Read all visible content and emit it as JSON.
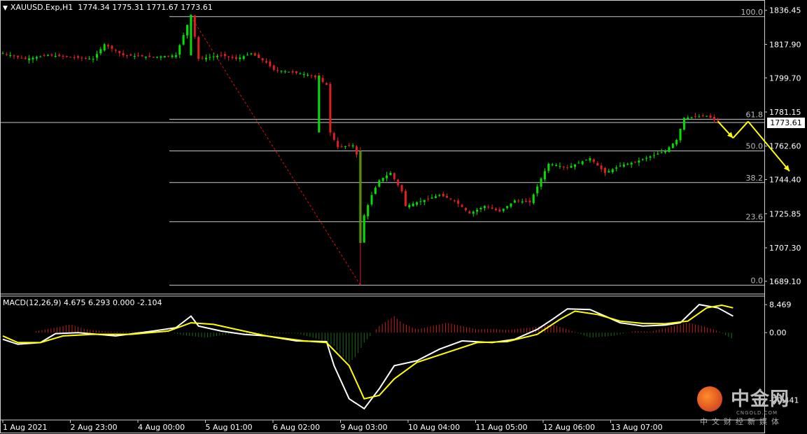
{
  "header": {
    "symbol": "XAUUSD.Exp,H1",
    "ohlc": "1774.34 1775.31 1771.67 1773.61"
  },
  "macd_header": {
    "label": "MACD(12,26,9) 4.675 6.293 0.000 -2.104"
  },
  "current_price": "1773.61",
  "logo": {
    "name": "中金网",
    "sub": "CNGOLD.COM",
    "tag": "中文财经新媒体"
  },
  "chart_data": [
    {
      "type": "candlestick",
      "title": "XAUUSD.Exp,H1",
      "price_axis_ticks": [
        "1836.45",
        "1817.90",
        "1799.70",
        "1781.15",
        "1762.60",
        "1744.40",
        "1725.85",
        "1707.30",
        "1689.10"
      ],
      "price_axis_values": [
        1836.45,
        1817.9,
        1799.7,
        1781.15,
        1762.6,
        1744.4,
        1725.85,
        1707.3,
        1689.1
      ],
      "ylim": [
        1686,
        1839
      ],
      "x_tick_labels": [
        "1 Aug 2021",
        "2 Aug 23:00",
        "4 Aug 00:00",
        "5 Aug 01:00",
        "6 Aug 02:00",
        "9 Aug 03:00",
        "10 Aug 04:00",
        "11 Aug 05:00",
        "12 Aug 06:00",
        "13 Aug 07:00"
      ],
      "fibonacci": {
        "high": 1833.0,
        "low": 1687.0,
        "levels": [
          {
            "label": "100.0",
            "price": 1833.0
          },
          {
            "label": "61.8",
            "price": 1777.2
          },
          {
            "label": "50.0",
            "price": 1760.0
          },
          {
            "label": "38.2",
            "price": 1742.8
          },
          {
            "label": "23.6",
            "price": 1721.5
          },
          {
            "label": "0.0",
            "price": 1687.0
          }
        ]
      },
      "price_path": [
        [
          0,
          1813
        ],
        [
          6,
          1810
        ],
        [
          12,
          1812
        ],
        [
          18,
          1811
        ],
        [
          24,
          1810
        ],
        [
          27,
          1818
        ],
        [
          32,
          1812
        ],
        [
          40,
          1811
        ],
        [
          46,
          1812
        ],
        [
          50,
          1834
        ],
        [
          52,
          1810
        ],
        [
          58,
          1812
        ],
        [
          62,
          1810
        ],
        [
          66,
          1813
        ],
        [
          70,
          1808
        ],
        [
          72,
          1804
        ],
        [
          76,
          1803
        ],
        [
          82,
          1801
        ],
        [
          84,
          1799
        ],
        [
          86,
          1796
        ],
        [
          87,
          1770
        ],
        [
          89,
          1762
        ],
        [
          93,
          1763
        ],
        [
          94,
          1758
        ],
        [
          95,
          1710
        ],
        [
          96,
          1725
        ],
        [
          98,
          1736
        ],
        [
          100,
          1744
        ],
        [
          103,
          1748
        ],
        [
          106,
          1738
        ],
        [
          107,
          1730
        ],
        [
          110,
          1732
        ],
        [
          116,
          1736
        ],
        [
          120,
          1733
        ],
        [
          124,
          1726
        ],
        [
          128,
          1730
        ],
        [
          132,
          1727
        ],
        [
          136,
          1733
        ],
        [
          140,
          1732
        ],
        [
          143,
          1745
        ],
        [
          145,
          1753
        ],
        [
          150,
          1751
        ],
        [
          156,
          1756
        ],
        [
          160,
          1748
        ],
        [
          164,
          1752
        ],
        [
          168,
          1754
        ],
        [
          172,
          1757
        ],
        [
          176,
          1760
        ],
        [
          179,
          1766
        ],
        [
          181,
          1778
        ],
        [
          187,
          1779
        ],
        [
          190,
          1776
        ]
      ],
      "current_price": 1773.61,
      "projection": [
        [
          190,
          1776
        ],
        [
          194,
          1767
        ],
        [
          198,
          1776
        ],
        [
          209,
          1749
        ]
      ]
    },
    {
      "type": "line",
      "title": "MACD(12,26,9)",
      "values_shown": {
        "macd": 4.675,
        "signal": 6.293,
        "level": 0.0,
        "histogram": -2.104
      },
      "axis_ticks": [
        "8.469",
        "0.00",
        "-20.441"
      ],
      "axis_values": [
        8.469,
        0.0,
        -20.441
      ],
      "ylim": [
        -26,
        10
      ],
      "series": [
        {
          "name": "MACD",
          "color": "#ffffff",
          "values": [
            [
              0,
              -2
            ],
            [
              4,
              -3.5
            ],
            [
              10,
              -3
            ],
            [
              14,
              -0.3
            ],
            [
              20,
              0
            ],
            [
              30,
              -1
            ],
            [
              40,
              0.5
            ],
            [
              46,
              1.5
            ],
            [
              50,
              5
            ],
            [
              52,
              2
            ],
            [
              58,
              0.5
            ],
            [
              64,
              -0.5
            ],
            [
              70,
              -1
            ],
            [
              78,
              -2.5
            ],
            [
              86,
              -2.7
            ],
            [
              88,
              -10
            ],
            [
              92,
              -20
            ],
            [
              96,
              -23
            ],
            [
              100,
              -17
            ],
            [
              104,
              -10
            ],
            [
              110,
              -8.5
            ],
            [
              116,
              -5
            ],
            [
              122,
              -2.5
            ],
            [
              130,
              -3
            ],
            [
              136,
              -2
            ],
            [
              142,
              1
            ],
            [
              146,
              4
            ],
            [
              150,
              7.2
            ],
            [
              156,
              7
            ],
            [
              160,
              5
            ],
            [
              164,
              3
            ],
            [
              170,
              2
            ],
            [
              176,
              2.3
            ],
            [
              180,
              3
            ],
            [
              185,
              8.5
            ],
            [
              190,
              7.5
            ],
            [
              194,
              5
            ]
          ]
        },
        {
          "name": "Signal",
          "color": "#ffff00",
          "values": [
            [
              0,
              -1
            ],
            [
              4,
              -3
            ],
            [
              10,
              -3
            ],
            [
              16,
              -1
            ],
            [
              24,
              -0.5
            ],
            [
              34,
              -0.5
            ],
            [
              44,
              0.5
            ],
            [
              50,
              3
            ],
            [
              56,
              2.5
            ],
            [
              62,
              1
            ],
            [
              70,
              -1
            ],
            [
              80,
              -2.5
            ],
            [
              86,
              -3
            ],
            [
              92,
              -10
            ],
            [
              96,
              -20
            ],
            [
              100,
              -19
            ],
            [
              104,
              -14
            ],
            [
              110,
              -9
            ],
            [
              118,
              -6
            ],
            [
              126,
              -3
            ],
            [
              134,
              -2.7
            ],
            [
              142,
              -0.5
            ],
            [
              148,
              4
            ],
            [
              152,
              6.5
            ],
            [
              158,
              5.5
            ],
            [
              164,
              3.5
            ],
            [
              170,
              2.8
            ],
            [
              176,
              2.7
            ],
            [
              182,
              3.5
            ],
            [
              187,
              7.5
            ],
            [
              191,
              8.3
            ],
            [
              194,
              7.5
            ]
          ]
        }
      ],
      "histogram": [
        [
          8,
          0.3
        ],
        [
          14,
          1.5
        ],
        [
          18,
          2.5
        ],
        [
          22,
          1
        ],
        [
          28,
          0.3
        ],
        [
          36,
          0.2
        ],
        [
          44,
          0.2
        ],
        [
          48,
          -0.8
        ],
        [
          54,
          -1.5
        ],
        [
          60,
          -0.5
        ],
        [
          70,
          -0.3
        ],
        [
          78,
          -0.2
        ],
        [
          84,
          -2
        ],
        [
          88,
          -4
        ],
        [
          90,
          -7
        ],
        [
          92,
          -9
        ],
        [
          94,
          -7
        ],
        [
          96,
          -3
        ],
        [
          100,
          2
        ],
        [
          104,
          5
        ],
        [
          106,
          3
        ],
        [
          110,
          1
        ],
        [
          114,
          2
        ],
        [
          118,
          3
        ],
        [
          122,
          2
        ],
        [
          126,
          1
        ],
        [
          130,
          1.2
        ],
        [
          134,
          0.8
        ],
        [
          140,
          1.5
        ],
        [
          146,
          2.5
        ],
        [
          150,
          1
        ],
        [
          156,
          -1.5
        ],
        [
          162,
          -1
        ],
        [
          168,
          0.5
        ],
        [
          172,
          0.3
        ],
        [
          178,
          2
        ],
        [
          182,
          3
        ],
        [
          186,
          2
        ],
        [
          190,
          0.5
        ],
        [
          194,
          -2
        ]
      ]
    }
  ]
}
